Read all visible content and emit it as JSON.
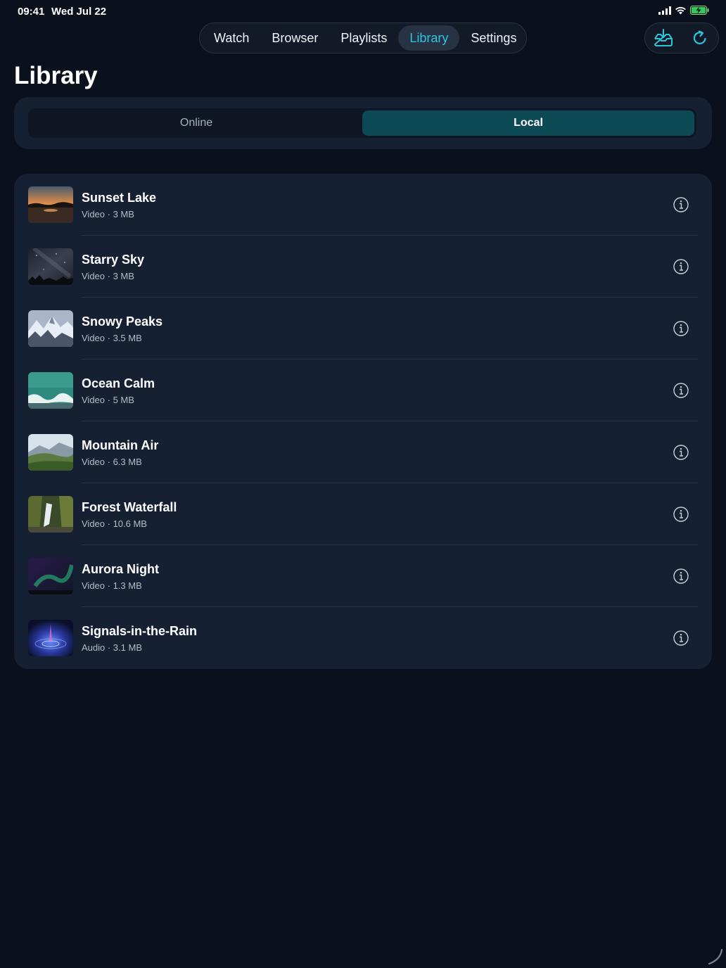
{
  "status_bar": {
    "time": "09:41",
    "date": "Wed Jul 22"
  },
  "nav": {
    "tabs": [
      {
        "label": "Watch",
        "active": false
      },
      {
        "label": "Browser",
        "active": false
      },
      {
        "label": "Playlists",
        "active": false
      },
      {
        "label": "Library",
        "active": true
      },
      {
        "label": "Settings",
        "active": false
      }
    ],
    "accent_color": "#2ec4dc"
  },
  "actions": {
    "download_icon": "tray-download-icon",
    "refresh_icon": "refresh-icon"
  },
  "page": {
    "title": "Library"
  },
  "scope": {
    "options": [
      "Online",
      "Local"
    ],
    "selected": "Local"
  },
  "items": [
    {
      "title": "Sunset Lake",
      "subtitle": "Video · 3 MB",
      "thumb": "sunset"
    },
    {
      "title": "Starry Sky",
      "subtitle": "Video · 3 MB",
      "thumb": "stars"
    },
    {
      "title": "Snowy Peaks",
      "subtitle": "Video · 3.5 MB",
      "thumb": "snow"
    },
    {
      "title": "Ocean Calm",
      "subtitle": "Video · 5 MB",
      "thumb": "ocean"
    },
    {
      "title": "Mountain Air",
      "subtitle": "Video · 6.3 MB",
      "thumb": "mountain"
    },
    {
      "title": "Forest Waterfall",
      "subtitle": "Video · 10.6 MB",
      "thumb": "waterfall"
    },
    {
      "title": "Aurora Night",
      "subtitle": "Video · 1.3 MB",
      "thumb": "aurora"
    },
    {
      "title": "Signals-in-the-Rain",
      "subtitle": "Audio · 3.1 MB",
      "thumb": "signals"
    }
  ]
}
